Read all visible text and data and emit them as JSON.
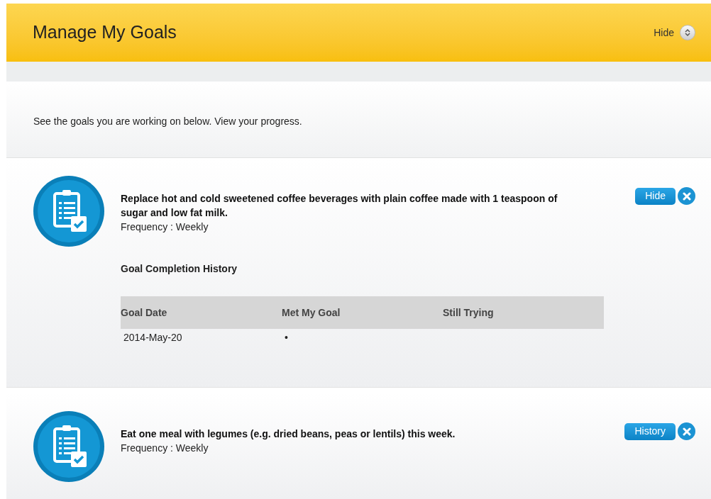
{
  "header": {
    "title": "Manage My Goals",
    "toggle_label": "Hide"
  },
  "intro": "See the goals you are working on below. View your progress.",
  "goals": [
    {
      "text": "Replace hot and cold sweetened coffee beverages with plain coffee made with 1 teaspoon of sugar and low fat milk.",
      "frequency": "Frequency : Weekly",
      "button": "Hide",
      "history": {
        "title": "Goal Completion History",
        "columns": [
          "Goal Date",
          "Met My Goal",
          "Still Trying"
        ],
        "rows": [
          [
            "2014-May-20",
            "•",
            ""
          ]
        ]
      }
    },
    {
      "text": "Eat one meal with legumes (e.g. dried beans, peas or lentils) this week.",
      "frequency": "Frequency : Weekly",
      "button": "History"
    }
  ]
}
